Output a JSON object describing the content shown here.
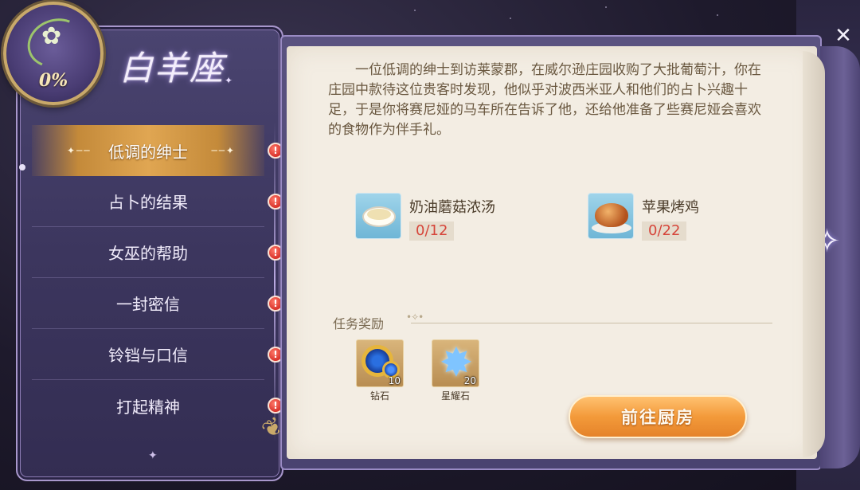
{
  "badge": {
    "progress_text": "0%"
  },
  "constellation": {
    "title": "白羊座"
  },
  "quests": [
    {
      "label": "低调的绅士",
      "active": true
    },
    {
      "label": "占卜的结果",
      "active": false
    },
    {
      "label": "女巫的帮助",
      "active": false
    },
    {
      "label": "一封密信",
      "active": false
    },
    {
      "label": "铃铛与口信",
      "active": false
    },
    {
      "label": "打起精神",
      "active": false
    }
  ],
  "alert_glyph": "!",
  "story": {
    "text": "一位低调的绅士到访莱蒙郡，在威尔逊庄园收购了大批葡萄汁，你在庄园中款待这位贵客时发现，他似乎对波西米亚人和他们的占卜兴趣十足，于是你将赛尼娅的马车所在告诉了他，还给他准备了些赛尼娅会喜欢的食物作为伴手礼。"
  },
  "requirements": [
    {
      "name": "奶油蘑菇浓汤",
      "progress": "0/12",
      "icon": "soup-icon"
    },
    {
      "name": "苹果烤鸡",
      "progress": "0/22",
      "icon": "roast-chicken-icon"
    }
  ],
  "rewards": {
    "title": "任务奖励",
    "items": [
      {
        "name": "钻石",
        "count": "10",
        "icon": "diamond-icon"
      },
      {
        "name": "星耀石",
        "count": "20",
        "icon": "star-stone-icon"
      }
    ]
  },
  "go_button": {
    "label": "前往厨房"
  },
  "colors": {
    "accent": "#e0a652",
    "alert": "#d8322a",
    "progress": "#d6453a",
    "button": "#f39a3a"
  }
}
